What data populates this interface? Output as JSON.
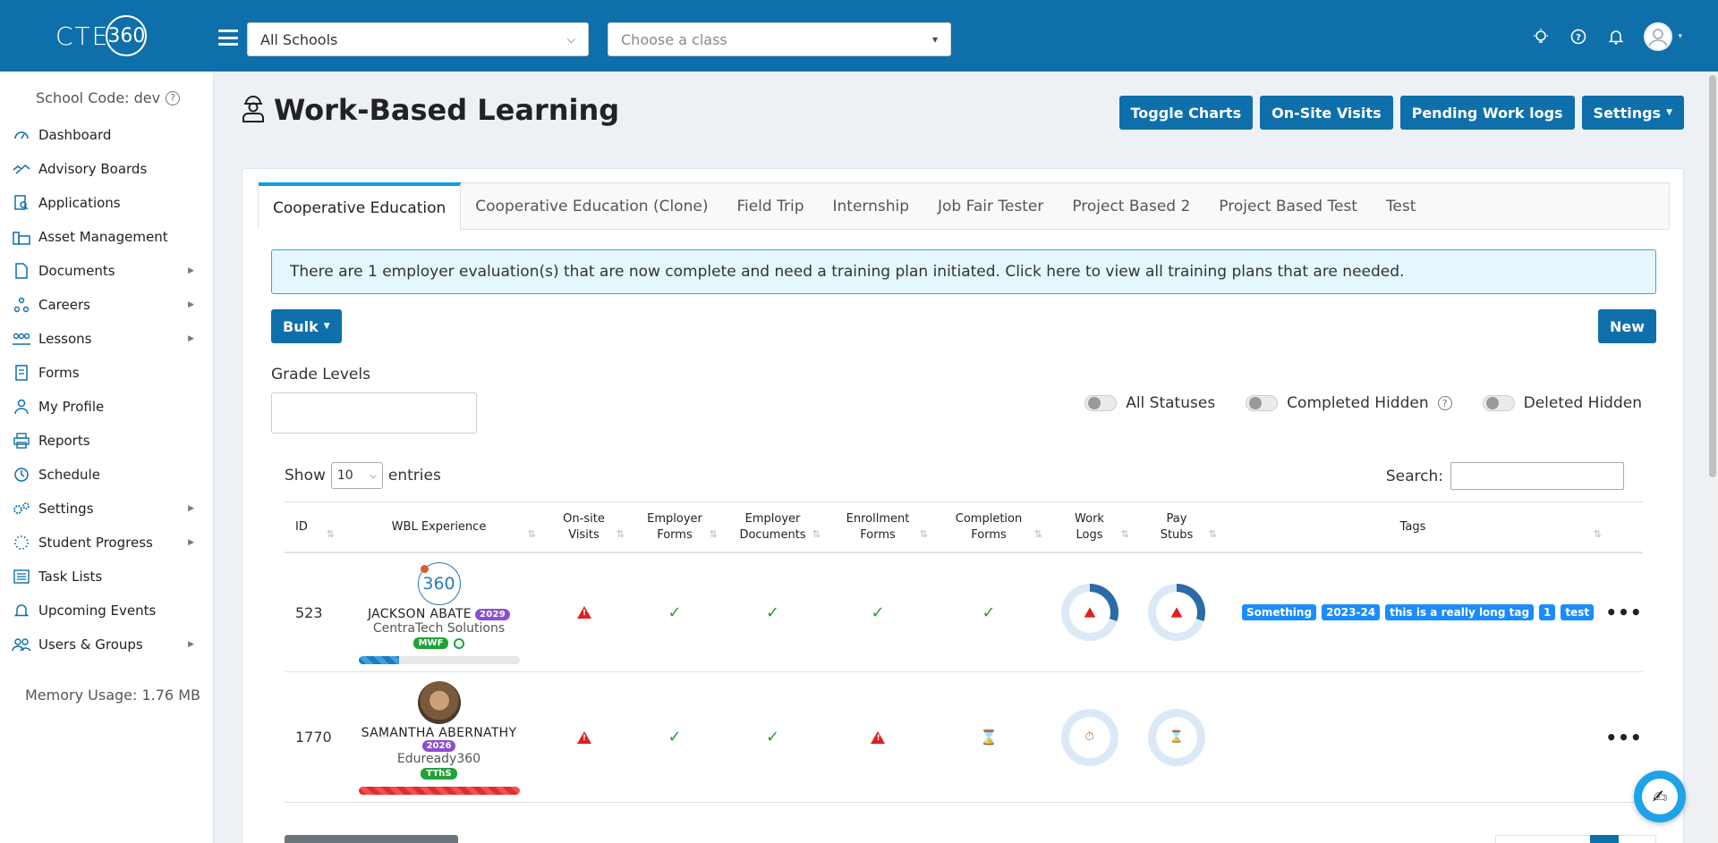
{
  "header": {
    "logo_text": "CTE",
    "logo_number": "360",
    "school_select": "All Schools",
    "class_select_placeholder": "Choose a class"
  },
  "sidebar": {
    "school_code": "School Code: dev",
    "items": [
      {
        "label": "Dashboard",
        "icon": "dashboard-icon",
        "has_children": false
      },
      {
        "label": "Advisory Boards",
        "icon": "handshake-icon",
        "has_children": false
      },
      {
        "label": "Applications",
        "icon": "search-document-icon",
        "has_children": false
      },
      {
        "label": "Asset Management",
        "icon": "building-icon",
        "has_children": false
      },
      {
        "label": "Documents",
        "icon": "document-icon",
        "has_children": true
      },
      {
        "label": "Careers",
        "icon": "people-network-icon",
        "has_children": true
      },
      {
        "label": "Lessons",
        "icon": "group-icon",
        "has_children": true
      },
      {
        "label": "Forms",
        "icon": "form-icon",
        "has_children": false
      },
      {
        "label": "My Profile",
        "icon": "user-icon",
        "has_children": false
      },
      {
        "label": "Reports",
        "icon": "printer-icon",
        "has_children": false
      },
      {
        "label": "Schedule",
        "icon": "clock-icon",
        "has_children": false
      },
      {
        "label": "Settings",
        "icon": "gears-icon",
        "has_children": true
      },
      {
        "label": "Student Progress",
        "icon": "spinner-icon",
        "has_children": true
      },
      {
        "label": "Task Lists",
        "icon": "list-icon",
        "has_children": false
      },
      {
        "label": "Upcoming Events",
        "icon": "bell-icon",
        "has_children": false
      },
      {
        "label": "Users & Groups",
        "icon": "users-icon",
        "has_children": true
      }
    ],
    "memory": "Memory Usage: 1.76 MB"
  },
  "page": {
    "title": "Work-Based Learning",
    "buttons": {
      "toggle_charts": "Toggle Charts",
      "onsite_visits": "On-Site Visits",
      "pending_work_logs": "Pending Work logs",
      "settings": "Settings"
    }
  },
  "tabs": [
    {
      "label": "Cooperative Education",
      "active": true
    },
    {
      "label": "Cooperative Education (Clone)",
      "active": false
    },
    {
      "label": "Field Trip",
      "active": false
    },
    {
      "label": "Internship",
      "active": false
    },
    {
      "label": "Job Fair Tester",
      "active": false
    },
    {
      "label": "Project Based 2",
      "active": false
    },
    {
      "label": "Project Based Test",
      "active": false
    },
    {
      "label": "Test",
      "active": false
    }
  ],
  "alert": "There are 1 employer evaluation(s) that are now complete and need a training plan initiated. Click here to view all training plans that are needed.",
  "controls": {
    "bulk": "Bulk",
    "new": "New",
    "grade_levels": "Grade Levels",
    "toggles": {
      "all_statuses": "All Statuses",
      "completed_hidden": "Completed Hidden",
      "deleted_hidden": "Deleted Hidden"
    },
    "show": "Show",
    "entries_value": "10",
    "entries": "entries",
    "search": "Search:"
  },
  "table": {
    "columns": {
      "id": "ID",
      "wbl": "WBL Experience",
      "onsite_1": "On-site",
      "onsite_2": "Visits",
      "emp_forms_1": "Employer",
      "emp_forms_2": "Forms",
      "emp_docs_1": "Employer",
      "emp_docs_2": "Documents",
      "enroll_1": "Enrollment",
      "enroll_2": "Forms",
      "completion_1": "Completion",
      "completion_2": "Forms",
      "work_logs_1": "Work",
      "work_logs_2": "Logs",
      "pay_stubs_1": "Pay",
      "pay_stubs_2": "Stubs",
      "tags": "Tags"
    },
    "rows": [
      {
        "id": "523",
        "avatar_text": "360",
        "name": "JACKSON ABATE",
        "year": "2029",
        "company": "CentraTech Solutions",
        "schedule": "MWF",
        "progress": 0.25,
        "onsite": "warning",
        "employer_forms": "check",
        "employer_docs": "check",
        "enrollment_forms": "check",
        "completion_forms": "check",
        "work_logs": {
          "status": "warning",
          "fraction": 0.3
        },
        "pay_stubs": {
          "status": "warning",
          "fraction": 0.3
        },
        "tags": [
          "Something",
          "2023-24",
          "this is a really long tag",
          "1",
          "test"
        ]
      },
      {
        "id": "1770",
        "avatar_text": "",
        "name": "SAMANTHA ABERNATHY",
        "year": "2026",
        "company": "Eduready360",
        "schedule": "TThS",
        "progress": 1.0,
        "onsite": "warning",
        "employer_forms": "check",
        "employer_docs": "check",
        "enrollment_forms": "warning",
        "completion_forms": "pending",
        "work_logs": {
          "status": "timer",
          "fraction": 0
        },
        "pay_stubs": {
          "status": "pending",
          "fraction": 0
        },
        "tags": []
      }
    ]
  },
  "colors": {
    "primary": "#0f6fab",
    "tag": "#1a8cff",
    "warning": "#e02020",
    "success": "#2a9a3a"
  }
}
